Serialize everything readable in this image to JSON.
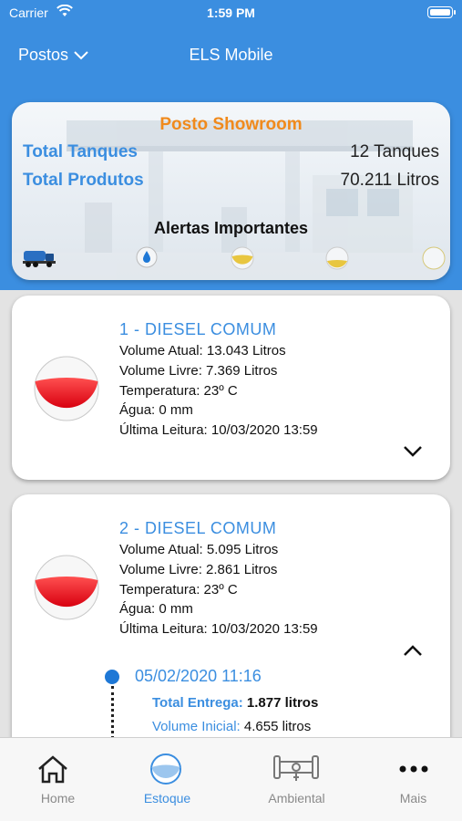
{
  "status_bar": {
    "carrier": "Carrier",
    "time": "1:59 PM"
  },
  "nav": {
    "menu_label": "Postos",
    "title": "ELS Mobile"
  },
  "hero": {
    "title": "Posto Showroom",
    "total_tanks_label": "Total Tanques",
    "total_tanks_value": "12 Tanques",
    "total_products_label": "Total Produtos",
    "total_products_value": "70.211 Litros",
    "alerts_label": "Alertas Importantes",
    "alert_icons": [
      "truck-icon",
      "water-drop-icon",
      "tank-yellow-icon",
      "tank-low-icon",
      "tank-empty-icon"
    ]
  },
  "tanks": [
    {
      "title": "1 - DIESEL COMUM",
      "volume_atual": "Volume Atual: 13.043 Litros",
      "volume_livre": "Volume Livre: 7.369 Litros",
      "temperatura": "Temperatura: 23º C",
      "agua": "Água: 0 mm",
      "ultima_leitura": "Última Leitura: 10/03/2020 13:59",
      "fill_fraction": 0.64,
      "expanded": false
    },
    {
      "title": "2 - DIESEL COMUM",
      "volume_atual": "Volume Atual: 5.095 Litros",
      "volume_livre": "Volume Livre: 2.861 Litros",
      "temperatura": "Temperatura: 23º C",
      "agua": "Água: 0 mm",
      "ultima_leitura": "Última Leitura: 10/03/2020 13:59",
      "fill_fraction": 0.64,
      "expanded": true,
      "history": {
        "date": "05/02/2020 11:16",
        "total_entrega_label": "Total Entrega:",
        "total_entrega_value": "1.877 litros",
        "volume_inicial_label": "Volume Inicial:",
        "volume_inicial_value": "4.655 litros"
      }
    }
  ],
  "tabs": [
    {
      "label": "Home",
      "icon": "home-icon",
      "active": false
    },
    {
      "label": "Estoque",
      "icon": "tank-gauge-icon",
      "active": true
    },
    {
      "label": "Ambiental",
      "icon": "pipe-sensor-icon",
      "active": false
    },
    {
      "label": "Mais",
      "icon": "more-icon",
      "active": false
    }
  ],
  "colors": {
    "primary": "#3b8ee0",
    "accent_orange": "#f08a1c",
    "tank_red": "#e8131c",
    "timeline_dot": "#1e78d6"
  }
}
